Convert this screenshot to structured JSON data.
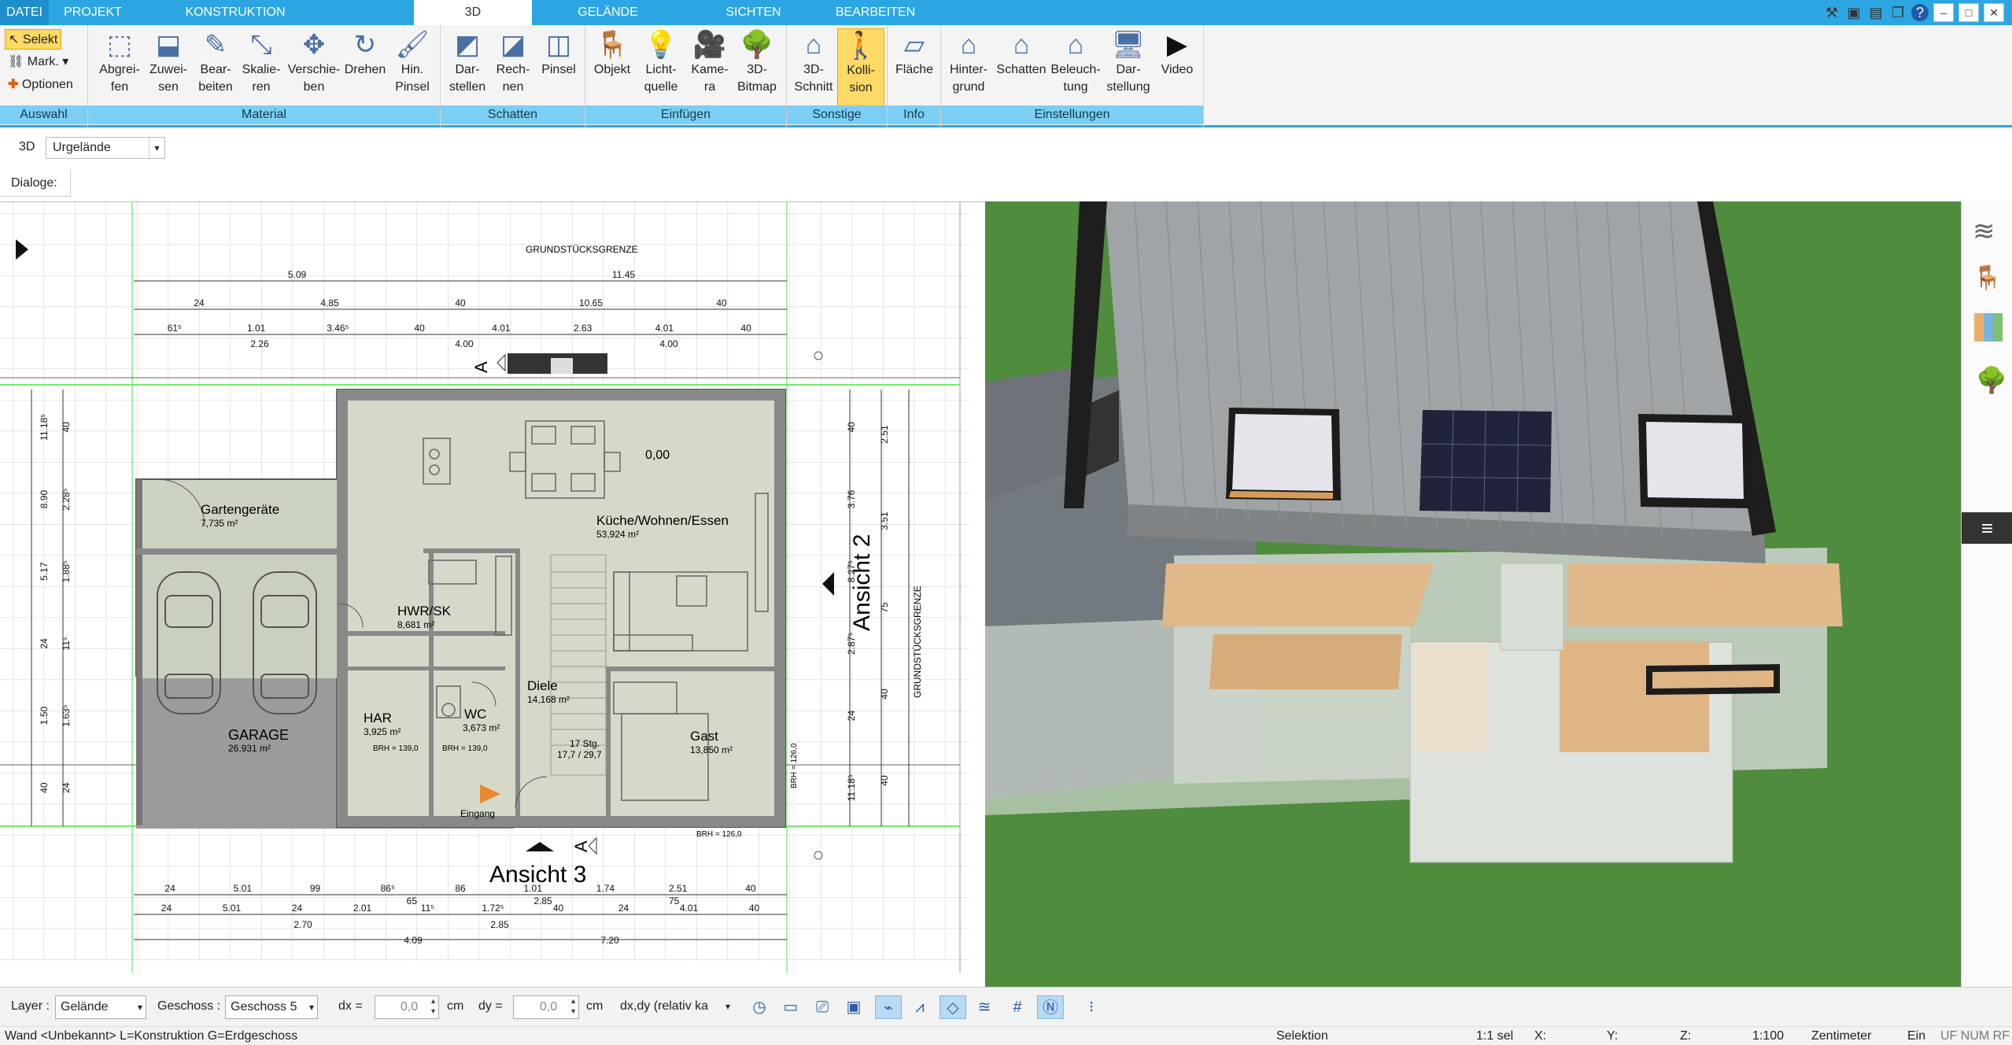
{
  "tabs": [
    {
      "label": "DATEI"
    },
    {
      "label": "PROJEKT"
    },
    {
      "label": "KONSTRUKTION"
    },
    {
      "label": "3D"
    },
    {
      "label": "GELÄNDE"
    },
    {
      "label": "SICHTEN"
    },
    {
      "label": "BEARBEITEN"
    }
  ],
  "window": {
    "restore": "▫",
    "minimize": "–",
    "maximize": "□",
    "close": "✕",
    "help": "?"
  },
  "ribbon": {
    "auswahl": {
      "label": "Auswahl",
      "selekt": "Selekt",
      "mark": "Mark.",
      "optionen": "Optionen"
    },
    "material": {
      "label": "Material",
      "items": [
        "Abgrei-\nfen",
        "Zuwei-\nsen",
        "Bear-\nbeiten",
        "Skalie-\nren",
        "Verschie-\nben",
        "Drehen",
        "Hin.\nPinsel"
      ]
    },
    "schatten": {
      "label": "Schatten",
      "items": [
        "Dar-\nstellen",
        "Rech-\nnen",
        "Pinsel"
      ]
    },
    "einfuegen": {
      "label": "Einfügen",
      "items": [
        "Objekt",
        "Licht-\nquelle",
        "Kame-\nra",
        "3D-\nBitmap"
      ]
    },
    "sonstige": {
      "label": "Sonstige",
      "items": [
        "3D-\nSchnitt",
        "Kolli-\nsion"
      ]
    },
    "info": {
      "label": "Info",
      "items": [
        "Fläche"
      ]
    },
    "einstellungen": {
      "label": "Einstellungen",
      "items": [
        "Hinter-\ngrund",
        "Schatten",
        "Beleuch-\ntung",
        "Dar-\nstellung",
        "Video"
      ]
    }
  },
  "view_row": {
    "mode": "3D",
    "layer_select": "Urgelände"
  },
  "dialoge_label": "Dialoge:",
  "plan": {
    "title_top": "GRUNDSTÜCKSGRENZE",
    "title_right": "GRUNDSTÜCKSGRENZE",
    "rooms": [
      {
        "name": "Gartengeräte",
        "area": "7,735 m²"
      },
      {
        "name": "Küche/Wohnen/Essen",
        "area": "53,924 m²"
      },
      {
        "name": "HWR/SK",
        "area": "8,681 m²"
      },
      {
        "name": "Diele",
        "area": "14,168 m²"
      },
      {
        "name": "HAR",
        "area": "3,925 m²"
      },
      {
        "name": "WC",
        "area": "3,673 m²"
      },
      {
        "name": "GARAGE",
        "area": "26,931 m²"
      },
      {
        "name": "Gast",
        "area": "13,850 m²"
      }
    ],
    "labels": {
      "ansicht2": "Ansicht 2",
      "ansicht3": "Ansicht 3",
      "eingang": "Eingang",
      "level": "0,00",
      "stairs": "17 Stg.",
      "stairs2": "17,7 / 29,7",
      "brh1": "BRH = 139,0",
      "brh2": "BRH = 139,0",
      "brh3": "BRH = 126,0",
      "brh4": "BRH = 126,0",
      "section_a": "A"
    },
    "dims_top": {
      "r1": [
        "5.09",
        "11.45"
      ],
      "r2": [
        "24",
        "4.85",
        "40",
        "10.65",
        "40"
      ],
      "r3": [
        "61⁵",
        "1.01",
        "3.46⁵",
        "40",
        "4.01",
        "2.63",
        "4.01",
        "40"
      ],
      "r4": [
        "2.26",
        "4.00",
        "4.00"
      ]
    },
    "dims_bottom": {
      "r1": [
        "24",
        "5.01",
        "99",
        "86⁵",
        "86",
        "1.01",
        "1.74",
        "2.51",
        "40"
      ],
      "r2": [
        "65",
        "2.85",
        "75"
      ],
      "r3": [
        "24",
        "5.01",
        "24",
        "2.01",
        "11⁵",
        "1.72⁵",
        "40",
        "24",
        "4.01",
        "40"
      ],
      "r4": [
        "2.70",
        "2.85"
      ],
      "r5": [
        "4.09",
        "7.20"
      ]
    },
    "dims_left": [
      "40",
      "2.28⁵",
      "1.88⁵",
      "11⁵",
      "1.63⁵",
      "24",
      "11.18⁵",
      "8.90",
      "5.17",
      "24",
      "1.50",
      "40"
    ],
    "dims_right": [
      "40",
      "3.76",
      "8.27⁵",
      "2.87⁵",
      "24",
      "11.18⁵",
      "2.51",
      "3.51",
      "75",
      "40",
      "40"
    ]
  },
  "bottom_toolbar": {
    "layer_label": "Layer :",
    "layer_value": "Gelände",
    "geschoss_label": "Geschoss :",
    "geschoss_value": "Geschoss 5",
    "dx_label": "dx =",
    "dx_value": "0,0",
    "dx_unit": "cm",
    "dy_label": "dy =",
    "dy_value": "0,0",
    "dy_unit": "cm",
    "mode_value": "dx,dy (relativ ka"
  },
  "status": {
    "left": "Wand <Unbekannt> L=Konstruktion G=Erdgeschoss",
    "selection": "Selektion",
    "sel_count": "1:1 sel",
    "x": "X:",
    "y": "Y:",
    "z": "Z:",
    "scale": "1:100",
    "unit": "Zentimeter",
    "ein": "Ein",
    "flags": "UF NUM RF"
  }
}
